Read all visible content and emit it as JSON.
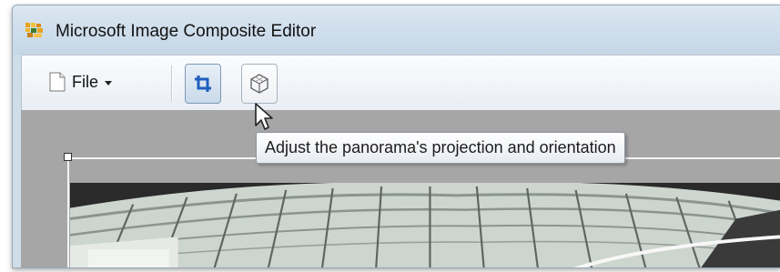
{
  "window": {
    "title": "Microsoft Image Composite Editor"
  },
  "toolbar": {
    "file_label": "File",
    "icons": {
      "file": "document-icon",
      "crop": "crop-icon",
      "projection": "cube-projection-icon"
    }
  },
  "tooltip": {
    "text": "Adjust the panorama's projection and orientation"
  },
  "colors": {
    "canvas": "#a6a6a6",
    "titlebar": "#cfdde9",
    "crop_active": "#1f5fbf"
  }
}
